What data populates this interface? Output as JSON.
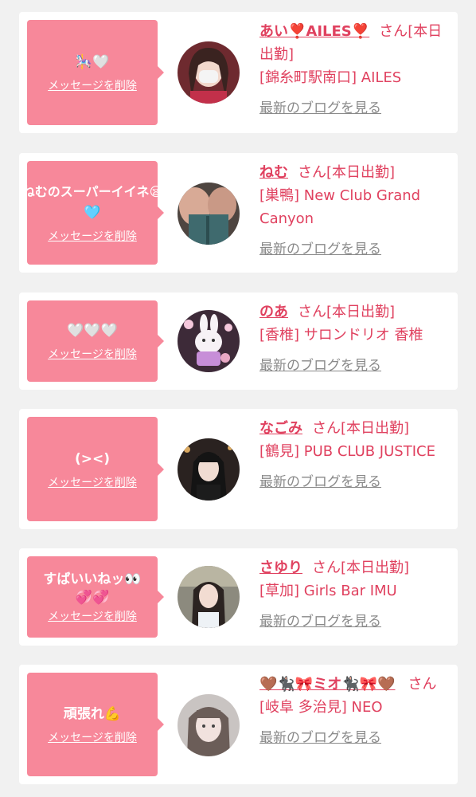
{
  "delete_label": "メッセージを削除",
  "blog_label": "最新のブログを見る",
  "honorific": "さん",
  "entries": [
    {
      "message": "🎠🤍",
      "name": "あい❣️AILES❣️",
      "status": "[本日出勤]",
      "shop": "[錦糸町駅南口] AILES"
    },
    {
      "message_lines": [
        "ねむのスーパーイイネ😪",
        "🩵"
      ],
      "name": "ねむ",
      "status": "[本日出勤]",
      "shop": "[巣鴨] New Club Grand Canyon"
    },
    {
      "message": "🤍🤍🤍",
      "name": "のあ",
      "status": "[本日出勤]",
      "shop": "[香椎] サロンドリオ 香椎"
    },
    {
      "message": "(><)",
      "name": "なごみ",
      "status": "[本日出勤]",
      "shop": "[鶴見] PUB CLUB JUSTICE"
    },
    {
      "message_lines": [
        "すばいいねッ👀",
        "💞💞"
      ],
      "name": "さゆり",
      "status": "[本日出勤]",
      "shop": "[草加] Girls Bar IMU"
    },
    {
      "message": "頑張れ💪",
      "name": "🤎🐈‍⬛🎀ミオ🐈‍⬛🎀🤎",
      "status": "",
      "shop": "[岐阜 多治見] NEO"
    }
  ],
  "colors": {
    "background": "#f1f1f1",
    "bubble": "#f7889a",
    "accent": "#e0415f",
    "link_gray": "#8a8a8a"
  }
}
